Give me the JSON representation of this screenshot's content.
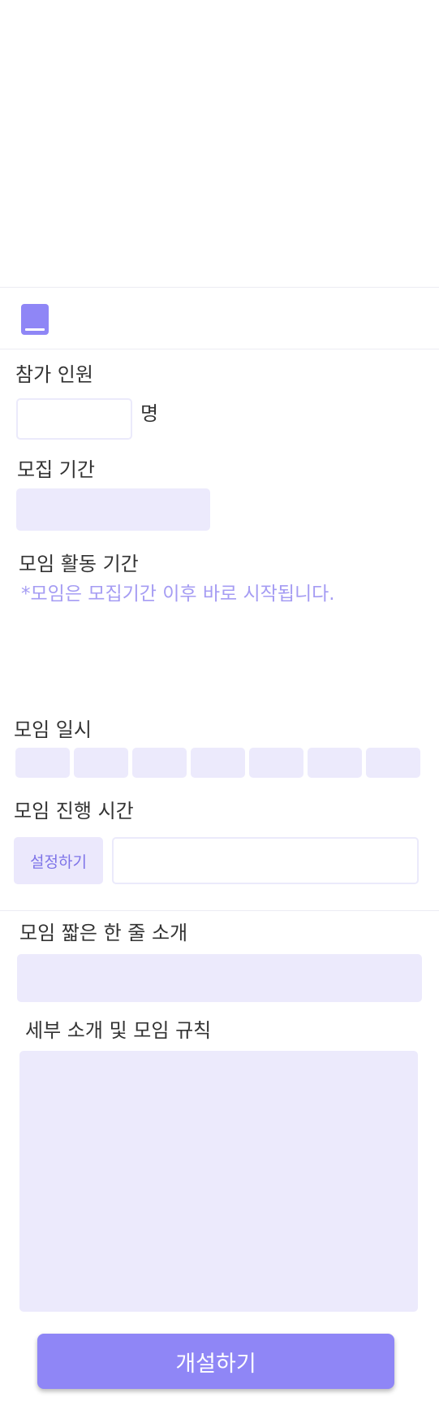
{
  "form": {
    "participants": {
      "label": "참가 인원",
      "unit": "명",
      "value": ""
    },
    "recruit_period": {
      "label": "모집 기간"
    },
    "activity_period": {
      "label": "모임 활동 기간",
      "note": "*모임은 모집기간 이후 바로 시작됩니다."
    },
    "meeting_days": {
      "label": "모임 일시",
      "day_count": 7
    },
    "meeting_time": {
      "label": "모임 진행 시간",
      "set_button": "설정하기",
      "value": ""
    },
    "short_intro": {
      "label": "모임 짧은 한 줄 소개",
      "value": ""
    },
    "details": {
      "label": "세부 소개 및 모임 규칙",
      "value": ""
    },
    "submit_label": "개설하기"
  },
  "icons": {
    "category": "book-icon"
  },
  "colors": {
    "accent": "#8f86f6",
    "field_fill": "#eceafc",
    "note": "#a59cf3",
    "text": "#333333"
  }
}
